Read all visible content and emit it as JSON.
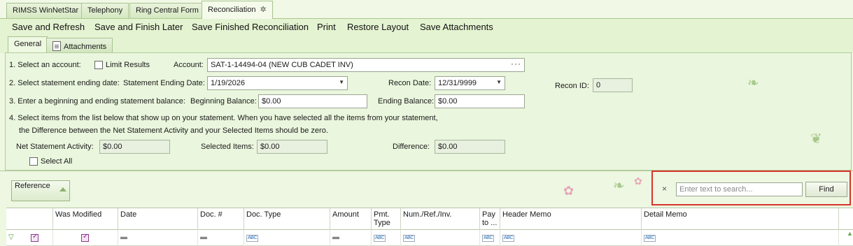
{
  "doc_tabs": [
    {
      "label": "RIMSS WinNetStar"
    },
    {
      "label": "Telephony"
    },
    {
      "label": "Ring Central Form"
    },
    {
      "label": "Reconciliation"
    }
  ],
  "toolbar": {
    "save_refresh": "Save and Refresh",
    "save_finish_later": "Save and Finish Later",
    "save_finished": "Save Finished Reconciliation",
    "print": "Print",
    "restore_layout": "Restore Layout",
    "save_attachments": "Save Attachments"
  },
  "inner_tabs": {
    "general": "General",
    "attachments": "Attachments"
  },
  "form": {
    "step1": "1. Select an account:",
    "limit_results": "Limit Results",
    "account_label": "Account:",
    "account_value": "SAT-1-14494-04 (NEW CUB CADET INV)",
    "step2": "2. Select statement ending date:",
    "statement_ending_date_label": "Statement Ending Date:",
    "statement_ending_date_value": "1/19/2026",
    "recon_date_label": "Recon Date:",
    "recon_date_value": "12/31/9999",
    "recon_id_label": "Recon ID:",
    "recon_id_value": "0",
    "step3": "3. Enter a beginning and ending statement balance:",
    "beginning_balance_label": "Beginning Balance:",
    "beginning_balance_value": "$0.00",
    "ending_balance_label": "Ending Balance:",
    "ending_balance_value": "$0.00",
    "step4_line1": "4. Select items from the list below that show up on your statement. When you have selected all the items from your statement,",
    "step4_line2": "the Difference between the Net Statement Activity and your Selected Items should be zero.",
    "net_activity_label": "Net Statement Activity:",
    "net_activity_value": "$0.00",
    "selected_items_label": "Selected Items:",
    "selected_items_value": "$0.00",
    "difference_label": "Difference:",
    "difference_value": "$0.00",
    "select_all": "Select All"
  },
  "grouping": {
    "reference": "Reference"
  },
  "search": {
    "placeholder": "Enter text to search...",
    "find": "Find"
  },
  "grid": {
    "columns": [
      "Was Modified",
      "Date",
      "Doc. #",
      "Doc. Type",
      "Amount",
      "Pmt. Type",
      "Num./Ref./Inv.",
      "Pay to ...",
      "Header Memo",
      "Detail Memo"
    ]
  }
}
